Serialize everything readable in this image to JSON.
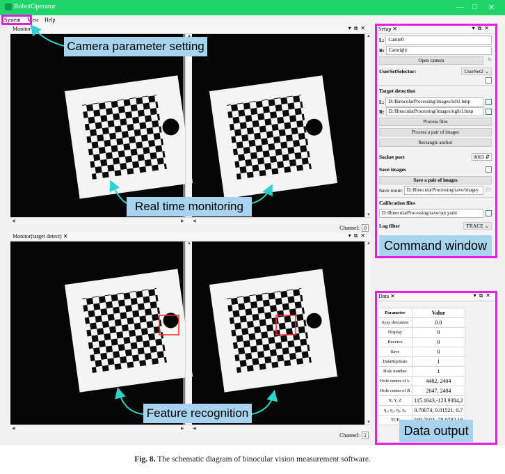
{
  "app": {
    "title": "RobotOperator"
  },
  "menu": [
    "System",
    "View",
    "Help"
  ],
  "monitor": {
    "tab": "Monitor",
    "channel_label": "Channel:",
    "channel_value": "0"
  },
  "monitor2": {
    "tab": "Monitor(target detect)",
    "channel_label": "Channel:",
    "channel_value": "2"
  },
  "setup": {
    "tab": "Setup",
    "l_label": "L:",
    "l_value": "Camleft",
    "r_label": "R:",
    "r_value": "Camright",
    "open_camera": "Open camera",
    "userset_label": "UserSetSelector:",
    "userset_value": "UserSet2",
    "target_detection": "Target detection",
    "target_l_label": "L:",
    "target_l_value": "D:/BinocularProcessing/images/left1.bmp",
    "target_r_label": "R:",
    "target_r_value": "D:/BinocularProcessing/images/right1.bmp",
    "process_files": "Process files",
    "process_pair": "Process a pair of images",
    "rectangle_anchor": "Rectangle anchor",
    "socket_label": "Socket port",
    "socket_value": "8003",
    "save_images_label": "Save images",
    "save_pair": "Save a pair of images",
    "save_route_label": "Save route:",
    "save_route_value": "D:/BinocularProcessing/save/images",
    "calibration_label": "Calibration files",
    "calibration_value": "D:/BinocularProcessing/save/out.yaml",
    "log_filter_label": "Log filter",
    "log_filter_value": "TRACE"
  },
  "data_panel": {
    "tab": "Data",
    "headers": [
      "Parameter",
      "Value"
    ],
    "rows": [
      [
        "Sync deviation",
        "0.0"
      ],
      [
        "Display",
        "0"
      ],
      [
        "Receive",
        "0"
      ],
      [
        "Save",
        "0"
      ],
      [
        "DataRqsState",
        "1"
      ],
      [
        "Hole number",
        "1"
      ],
      [
        "Hole center of L",
        "4482, 2404"
      ],
      [
        "Hole center of R",
        "2647, 2404"
      ],
      [
        "X, Y, Z",
        "115.1643,-123.9384,2"
      ],
      [
        "q₁, q₂, q₃, q₄",
        "0.70074, 0.01521, 0.7"
      ],
      [
        "TCP",
        "169.7604,-78.9783,18"
      ]
    ]
  },
  "callouts": {
    "camera": "Camera parameter setting",
    "realtime": "Real time monitoring",
    "feature": "Feature recognition",
    "command": "Command window",
    "data": "Data output"
  },
  "caption": {
    "label": "Fig. 8.",
    "text": "The schematic diagram of binocular vision measurement software."
  },
  "colors": {
    "titlebar": "#1fd46b",
    "highlight": "#e41fe0",
    "callout": "#a7d3ee",
    "arrow": "#2bd3cc",
    "target_box": "#ff2a2a"
  }
}
